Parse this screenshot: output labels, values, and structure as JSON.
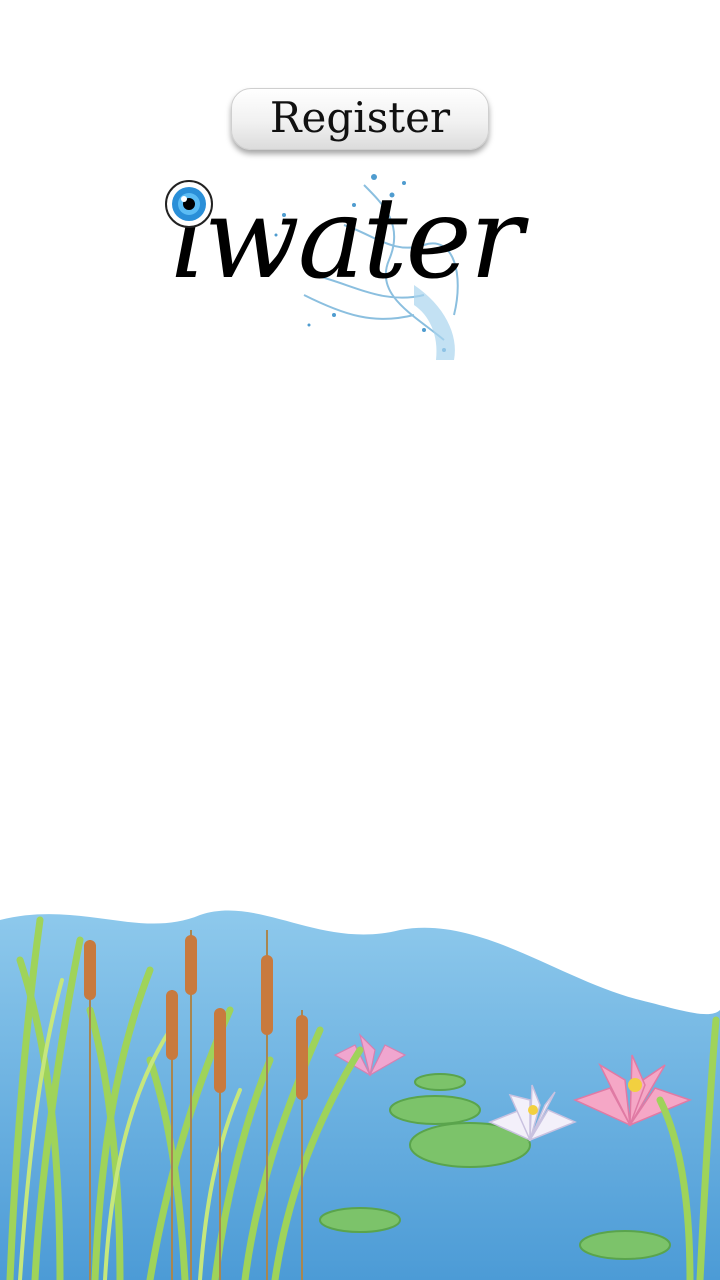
{
  "register_button": {
    "label": "Register"
  },
  "logo": {
    "text": "iwater",
    "icons": [
      "eye-icon",
      "water-splash"
    ]
  },
  "background": {
    "scene": "pond-illustration",
    "water_color": "#5aa8dc",
    "reed_color": "#8cc44a",
    "cattail_color": "#c87a3e",
    "lily_pink": "#f08bb5"
  }
}
